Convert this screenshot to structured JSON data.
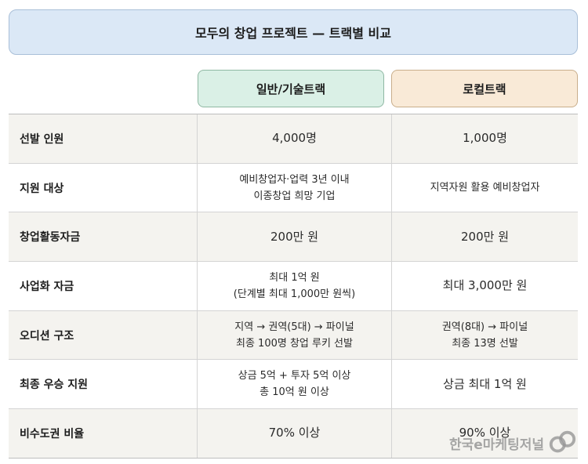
{
  "title": "모두의 창업 프로젝트 — 트랙별 비교",
  "tracks": {
    "general": "일반/기술트랙",
    "local": "로컬트랙"
  },
  "rows": [
    {
      "label": "선발 인원",
      "general": [
        "4,000명"
      ],
      "local": [
        "1,000명"
      ],
      "general_size": "big",
      "local_size": "big"
    },
    {
      "label": "지원 대상",
      "general": [
        "예비창업자·업력 3년 이내",
        "이종창업 희망 기업"
      ],
      "local": [
        "지역자원 활용 예비창업자"
      ],
      "general_size": "small",
      "local_size": "small"
    },
    {
      "label": "창업활동자금",
      "general": [
        "200만 원"
      ],
      "local": [
        "200만 원"
      ],
      "general_size": "big",
      "local_size": "big"
    },
    {
      "label": "사업화 자금",
      "general": [
        "최대 1억 원",
        "(단계별 최대 1,000만 원씩)"
      ],
      "local": [
        "최대 3,000만 원"
      ],
      "general_size": "small",
      "local_size": "big"
    },
    {
      "label": "오디션 구조",
      "general": [
        "지역 → 권역(5대) → 파이널",
        "최종 100명 창업 루키 선발"
      ],
      "local": [
        "권역(8대) → 파이널",
        "최종 13명 선발"
      ],
      "general_size": "small",
      "local_size": "small"
    },
    {
      "label": "최종 우승 지원",
      "general": [
        "상금 5억 + 투자 5억 이상",
        "총 10억 원 이상"
      ],
      "local": [
        "상금 최대 1억 원"
      ],
      "general_size": "small",
      "local_size": "big"
    },
    {
      "label": "비수도권 비율",
      "general": [
        "70% 이상"
      ],
      "local": [
        "90% 이상"
      ],
      "general_size": "big",
      "local_size": "big"
    }
  ],
  "watermark": "한국e마케팅저널"
}
